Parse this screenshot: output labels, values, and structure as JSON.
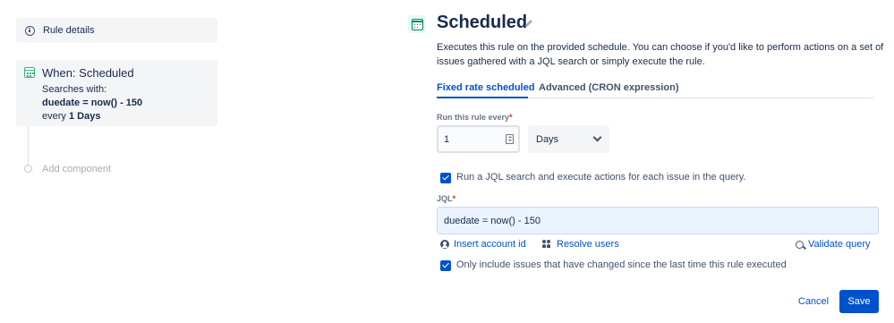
{
  "sidebar": {
    "rule_details_label": "Rule details",
    "trigger": {
      "title": "When: Scheduled",
      "searches_label": "Searches with:",
      "jql": "duedate = now() - 150",
      "every_prefix": "every",
      "every_value": "1 Days"
    },
    "add_component_label": "Add component"
  },
  "header": {
    "title": "Scheduled",
    "description": "Executes this rule on the provided schedule. You can choose if you'd like to perform actions on a set of issues gathered with a JQL search or simply execute the rule."
  },
  "tabs": [
    {
      "label": "Fixed rate scheduled",
      "active": true
    },
    {
      "label": "Advanced (CRON expression)",
      "active": false
    }
  ],
  "schedule": {
    "label": "Run this rule every",
    "required_mark": "*",
    "interval_value": "1",
    "unit_value": "Days"
  },
  "jql_section": {
    "run_jql_label": "Run a JQL search and execute actions for each issue in the query.",
    "run_jql_checked": true,
    "jql_label": "JQL",
    "required_mark": "*",
    "jql_value": "duedate = now() - 150",
    "insert_account_id": "Insert account id",
    "resolve_users": "Resolve users",
    "validate_query": "Validate query",
    "only_changed_label": "Only include issues that have changed since the last time this rule executed",
    "only_changed_checked": true
  },
  "footer": {
    "cancel_label": "Cancel",
    "save_label": "Save"
  },
  "icons": {
    "rule_details": "info-icon",
    "trigger": "calendar-icon",
    "title_edit": "pencil-icon",
    "number_spinner": "spinner-icon",
    "unit_dropdown": "chevron-down-icon",
    "insert_account": "person-icon",
    "resolve_users": "users-icon",
    "validate": "search-icon"
  },
  "colors": {
    "accent": "#0052cc",
    "trigger_green": "#00875a",
    "text": "#172b4d",
    "required": "#de350b"
  }
}
